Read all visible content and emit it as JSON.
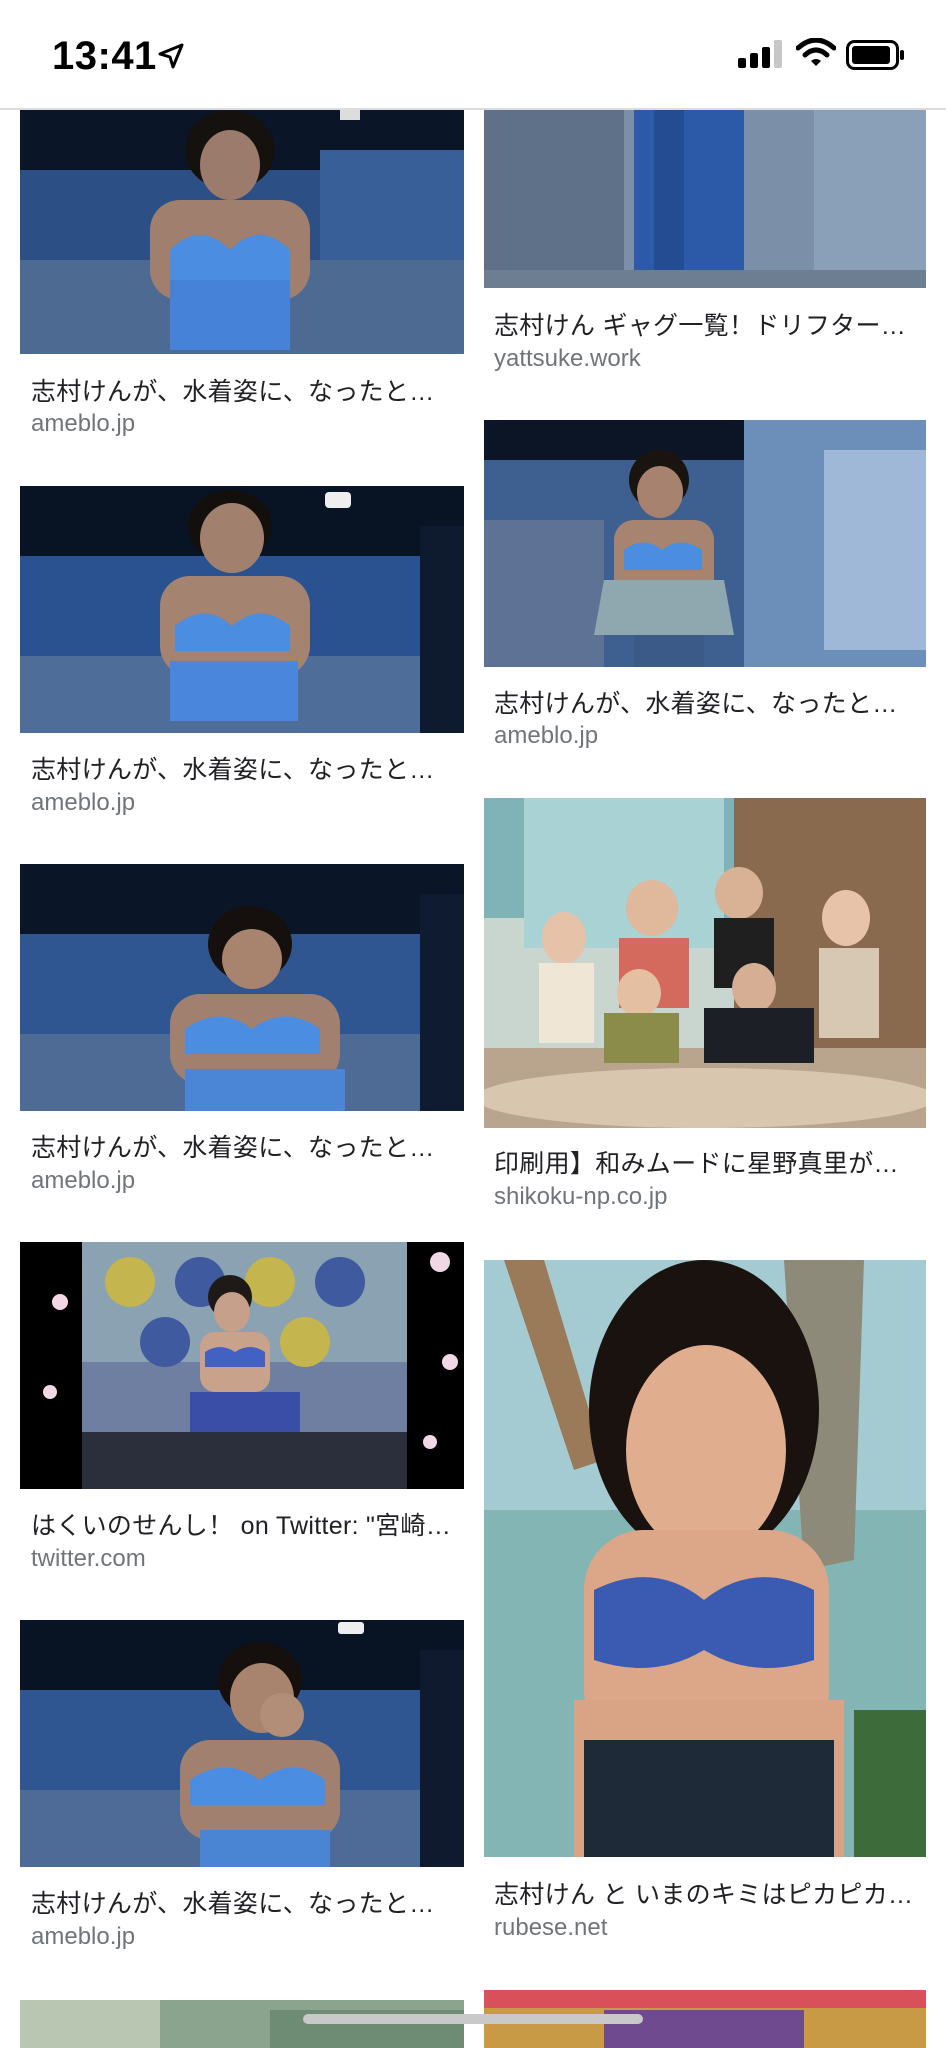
{
  "status_bar": {
    "time": "13:41"
  },
  "results": [
    {
      "caption": "志村けんが、水着姿に、なったと…",
      "source": "ameblo.jp"
    },
    {
      "caption": "志村けん ギャグ一覧！ドリフター…",
      "source": "yattsuke.work"
    },
    {
      "caption": "志村けんが、水着姿に、なったと…",
      "source": "ameblo.jp"
    },
    {
      "caption": "志村けんが、水着姿に、なったと…",
      "source": "ameblo.jp"
    },
    {
      "caption": "志村けんが、水着姿に、なったと…",
      "source": "ameblo.jp"
    },
    {
      "caption": "印刷用】和みムードに星野真里が…",
      "source": "shikoku-np.co.jp"
    },
    {
      "caption": "はくいのせんし！ on Twitter: \"宮崎…",
      "source": "twitter.com"
    },
    {
      "caption": "志村けん と いまのキミはピカピカ…",
      "source": "rubese.net"
    },
    {
      "caption": "志村けんが、水着姿に、なったと…",
      "source": "ameblo.jp"
    }
  ]
}
